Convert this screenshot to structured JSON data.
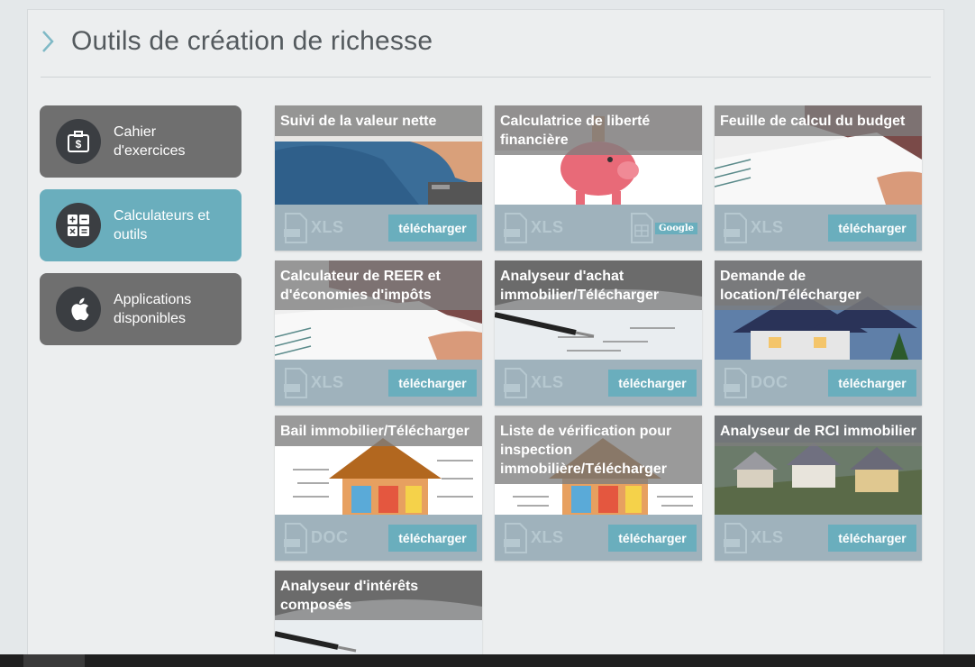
{
  "header": {
    "title": "Outils de création de richesse"
  },
  "sidebar": {
    "items": [
      {
        "label": "Cahier d'exercices",
        "icon": "briefcase-dollar-icon",
        "active": false
      },
      {
        "label": "Calculateurs et outils",
        "icon": "calculator-icon",
        "active": true
      },
      {
        "label": "Applications disponibles",
        "icon": "apple-icon",
        "active": false
      }
    ]
  },
  "cards": [
    {
      "title": "Suivi de la valeur nette",
      "filetype": "XLS",
      "button": "télécharger"
    },
    {
      "title": "Calculatrice de liberté financière",
      "filetype": "XLS",
      "google_label": "Google"
    },
    {
      "title": "Feuille de calcul du budget",
      "filetype": "XLS",
      "button": "télécharger"
    },
    {
      "title": "Calculateur de REER et d'économies d'impôts",
      "filetype": "XLS",
      "button": "télécharger"
    },
    {
      "title": "Analyseur d'achat immobilier/Télécharger",
      "filetype": "XLS",
      "button": "télécharger"
    },
    {
      "title": "Demande de location/Télécharger",
      "filetype": "DOC",
      "button": "télécharger"
    },
    {
      "title": "Bail immobilier/Télécharger",
      "filetype": "DOC",
      "button": "télécharger"
    },
    {
      "title": "Liste de vérification pour inspection immobilière/Télécharger",
      "filetype": "XLS",
      "button": "télécharger"
    },
    {
      "title": "Analyseur de RCI immobilier",
      "filetype": "XLS",
      "button": "télécharger"
    },
    {
      "title": "Analyseur d'intérêts composés"
    }
  ],
  "colors": {
    "accent": "#6aaebd",
    "sidebar": "#6f6f6f",
    "card_footer": "#9fb2bc"
  }
}
